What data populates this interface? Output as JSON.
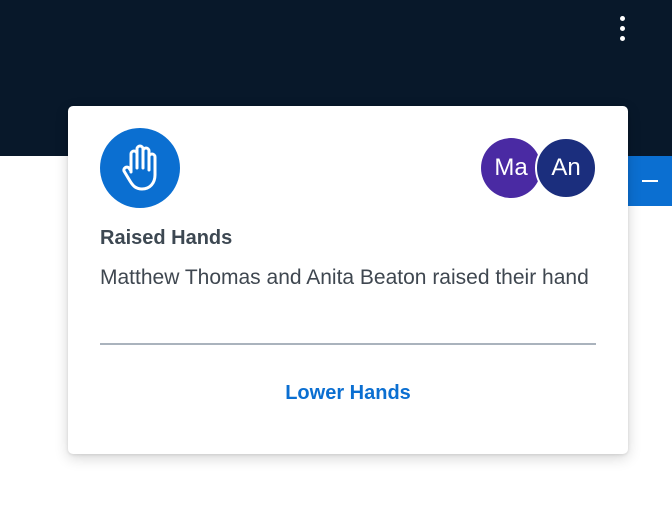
{
  "header": {
    "menu_icon": "more-vertical-icon"
  },
  "side_tab": {
    "icon": "minus-icon",
    "color": "#0b6fd1"
  },
  "notification": {
    "icon": "raised-hand-icon",
    "icon_bg": "#0b6fd1",
    "avatars": [
      {
        "initials": "Ma",
        "color": "#4a2aa3"
      },
      {
        "initials": "An",
        "color": "#1b2e7d"
      }
    ],
    "title": "Raised Hands",
    "message": "Matthew Thomas and Anita Beaton raised their hand",
    "action_label": "Lower Hands"
  }
}
